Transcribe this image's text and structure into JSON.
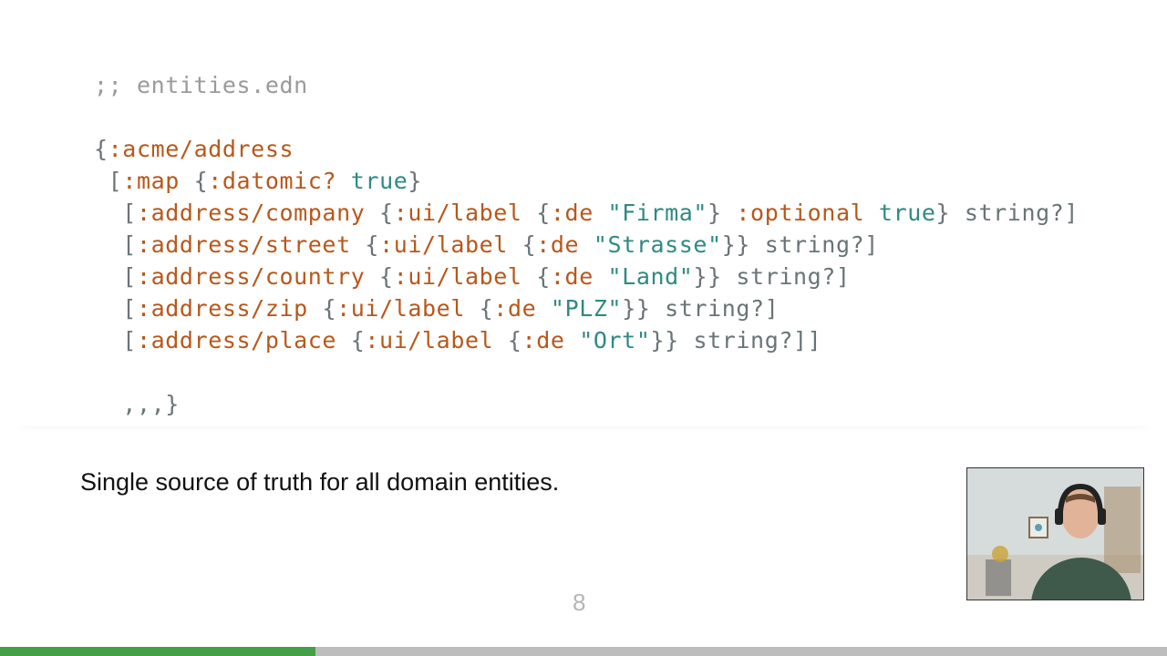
{
  "slide": {
    "code_lines": [
      [
        {
          "t": ";; entities.edn",
          "k": "comment"
        }
      ],
      [
        {
          "t": "",
          "k": "plain"
        }
      ],
      [
        {
          "t": "{",
          "k": "punct"
        },
        {
          "t": ":acme/address",
          "k": "kw"
        }
      ],
      [
        {
          "t": " [",
          "k": "punct"
        },
        {
          "t": ":map",
          "k": "kw"
        },
        {
          "t": " {",
          "k": "punct"
        },
        {
          "t": ":datomic?",
          "k": "kw"
        },
        {
          "t": " ",
          "k": "plain"
        },
        {
          "t": "true",
          "k": "bool"
        },
        {
          "t": "}",
          "k": "punct"
        }
      ],
      [
        {
          "t": "  [",
          "k": "punct"
        },
        {
          "t": ":address/company",
          "k": "kw"
        },
        {
          "t": " {",
          "k": "punct"
        },
        {
          "t": ":ui/label",
          "k": "kw"
        },
        {
          "t": " {",
          "k": "punct"
        },
        {
          "t": ":de",
          "k": "kw"
        },
        {
          "t": " ",
          "k": "plain"
        },
        {
          "t": "\"Firma\"",
          "k": "str"
        },
        {
          "t": "} ",
          "k": "punct"
        },
        {
          "t": ":optional",
          "k": "kw"
        },
        {
          "t": " ",
          "k": "plain"
        },
        {
          "t": "true",
          "k": "bool"
        },
        {
          "t": "} string?]",
          "k": "punct"
        }
      ],
      [
        {
          "t": "  [",
          "k": "punct"
        },
        {
          "t": ":address/street",
          "k": "kw"
        },
        {
          "t": " {",
          "k": "punct"
        },
        {
          "t": ":ui/label",
          "k": "kw"
        },
        {
          "t": " {",
          "k": "punct"
        },
        {
          "t": ":de",
          "k": "kw"
        },
        {
          "t": " ",
          "k": "plain"
        },
        {
          "t": "\"Strasse\"",
          "k": "str"
        },
        {
          "t": "}} string?]",
          "k": "punct"
        }
      ],
      [
        {
          "t": "  [",
          "k": "punct"
        },
        {
          "t": ":address/country",
          "k": "kw"
        },
        {
          "t": " {",
          "k": "punct"
        },
        {
          "t": ":ui/label",
          "k": "kw"
        },
        {
          "t": " {",
          "k": "punct"
        },
        {
          "t": ":de",
          "k": "kw"
        },
        {
          "t": " ",
          "k": "plain"
        },
        {
          "t": "\"Land\"",
          "k": "str"
        },
        {
          "t": "}} string?]",
          "k": "punct"
        }
      ],
      [
        {
          "t": "  [",
          "k": "punct"
        },
        {
          "t": ":address/zip",
          "k": "kw"
        },
        {
          "t": " {",
          "k": "punct"
        },
        {
          "t": ":ui/label",
          "k": "kw"
        },
        {
          "t": " {",
          "k": "punct"
        },
        {
          "t": ":de",
          "k": "kw"
        },
        {
          "t": " ",
          "k": "plain"
        },
        {
          "t": "\"PLZ\"",
          "k": "str"
        },
        {
          "t": "}} string?]",
          "k": "punct"
        }
      ],
      [
        {
          "t": "  [",
          "k": "punct"
        },
        {
          "t": ":address/place",
          "k": "kw"
        },
        {
          "t": " {",
          "k": "punct"
        },
        {
          "t": ":ui/label",
          "k": "kw"
        },
        {
          "t": " {",
          "k": "punct"
        },
        {
          "t": ":de",
          "k": "kw"
        },
        {
          "t": " ",
          "k": "plain"
        },
        {
          "t": "\"Ort\"",
          "k": "str"
        },
        {
          "t": "}} string?]]",
          "k": "punct"
        }
      ],
      [
        {
          "t": "",
          "k": "plain"
        }
      ],
      [
        {
          "t": "  ,,,}",
          "k": "punct"
        }
      ]
    ],
    "caption": "Single source of truth for all domain entities.",
    "page_number": "8"
  },
  "progress": {
    "fraction": 0.27
  },
  "colors": {
    "keyword": "#b8571a",
    "literal": "#2f8a82",
    "comment": "#9a9a9a",
    "progress_fill": "#43a047",
    "progress_track": "#bdbdbd"
  }
}
